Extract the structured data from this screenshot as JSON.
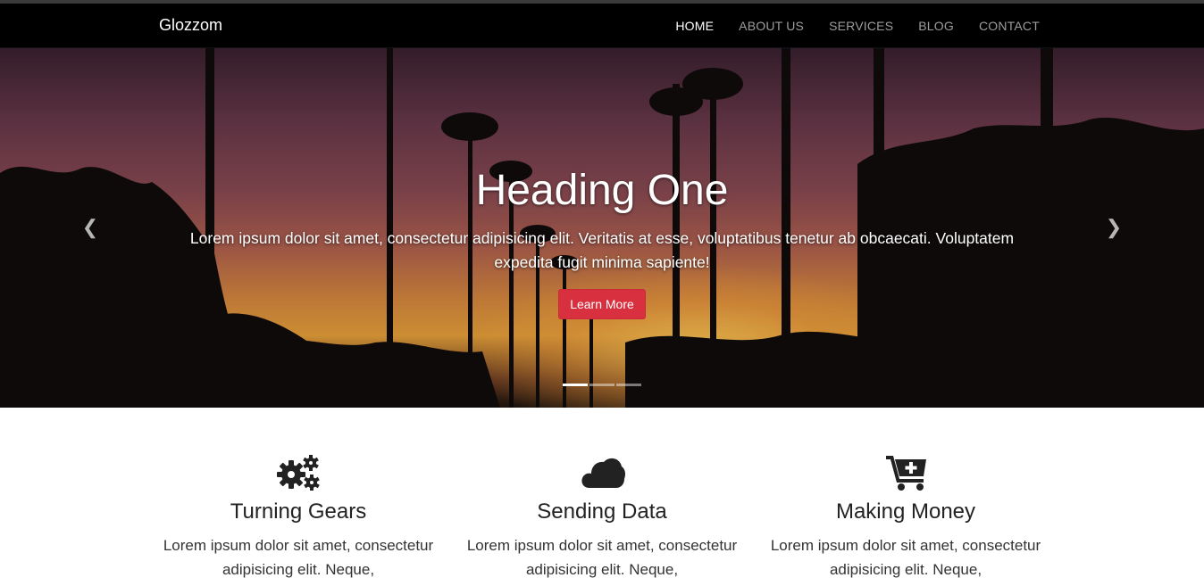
{
  "brand": "Glozzom",
  "nav": {
    "items": [
      {
        "label": "HOME",
        "active": true
      },
      {
        "label": "ABOUT US",
        "active": false
      },
      {
        "label": "SERVICES",
        "active": false
      },
      {
        "label": "BLOG",
        "active": false
      },
      {
        "label": "CONTACT",
        "active": false
      }
    ]
  },
  "carousel": {
    "heading": "Heading One",
    "text": "Lorem ipsum dolor sit amet, consectetur adipisicing elit. Veritatis at esse, voluptatibus tenetur ab obcaecati. Voluptatem expedita fugit minima sapiente!",
    "button_label": "Learn More",
    "prev_icon": "chevron-left-icon",
    "next_icon": "chevron-right-icon",
    "slide_count": 3,
    "active_slide": 1
  },
  "features": [
    {
      "icon": "gears-icon",
      "title": "Turning Gears",
      "text": "Lorem ipsum dolor sit amet, consectetur adipisicing elit. Neque,"
    },
    {
      "icon": "cloud-icon",
      "title": "Sending Data",
      "text": "Lorem ipsum dolor sit amet, consectetur adipisicing elit. Neque,"
    },
    {
      "icon": "cart-plus-icon",
      "title": "Making Money",
      "text": "Lorem ipsum dolor sit amet, consectetur adipisicing elit. Neque,"
    }
  ],
  "colors": {
    "navbar": "#000000",
    "accent_button": "#d9303f",
    "icon": "#222222"
  }
}
